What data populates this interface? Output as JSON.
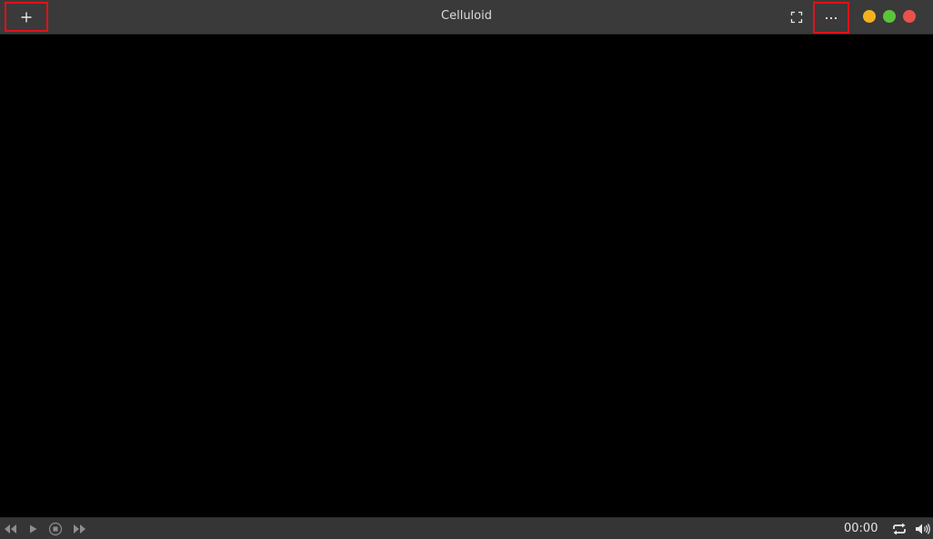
{
  "window": {
    "title": "Celluloid"
  },
  "titlebar": {
    "add_icon": "plus-icon",
    "fullscreen_icon": "fullscreen-icon",
    "menu_icon": "more-horizontal-icon",
    "window_controls": {
      "minimize_color": "#f3b21d",
      "maximize_color": "#5bc43a",
      "close_color": "#e9524a"
    },
    "highlight_color": "#e3101a"
  },
  "controls": {
    "rewind_icon": "rewind-icon",
    "play_icon": "play-icon",
    "stop_icon": "stop-icon",
    "forward_icon": "fast-forward-icon",
    "time": "00:00",
    "loop_icon": "loop-icon",
    "volume_icon": "volume-icon"
  }
}
